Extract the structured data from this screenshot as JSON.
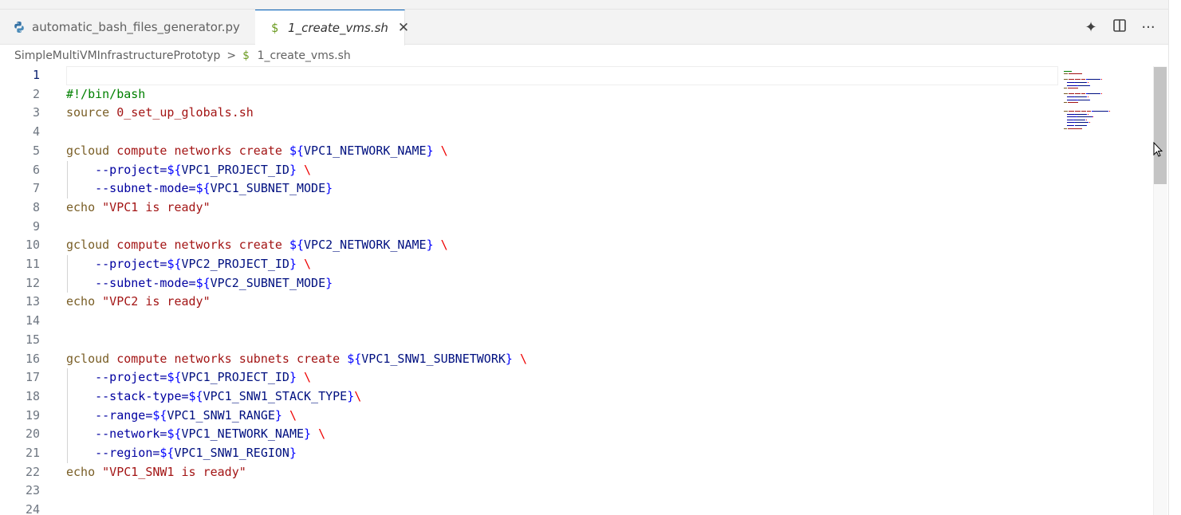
{
  "tabs": [
    {
      "label": "automatic_bash_files_generator.py",
      "icon": "python-icon",
      "active": false
    },
    {
      "label": "1_create_vms.sh",
      "icon": "dollar-icon",
      "active": true
    }
  ],
  "tab_icon_glyphs": {
    "dollar": "$",
    "close": "✕"
  },
  "actions": {
    "sparkle": "✦",
    "split": "◫",
    "more": "···"
  },
  "breadcrumb": {
    "folder": "SimpleMultiVMInfrastructurePrototyp",
    "separator": ">",
    "file_icon": "$",
    "file": "1_create_vms.sh"
  },
  "editor": {
    "current_line": 1,
    "lines": [
      {
        "n": "1",
        "tokens": []
      },
      {
        "n": "2",
        "tokens": [
          {
            "c": "shebang",
            "t": "#!/bin/bash"
          }
        ]
      },
      {
        "n": "3",
        "tokens": [
          {
            "c": "cmd",
            "t": "source"
          },
          {
            "c": "plain",
            "t": " "
          },
          {
            "c": "arg",
            "t": "0_set_up_globals.sh"
          }
        ]
      },
      {
        "n": "4",
        "tokens": []
      },
      {
        "n": "5",
        "tokens": [
          {
            "c": "cmd",
            "t": "gcloud"
          },
          {
            "c": "plain",
            "t": " "
          },
          {
            "c": "arg",
            "t": "compute"
          },
          {
            "c": "plain",
            "t": " "
          },
          {
            "c": "arg",
            "t": "networks"
          },
          {
            "c": "plain",
            "t": " "
          },
          {
            "c": "arg",
            "t": "create"
          },
          {
            "c": "plain",
            "t": " "
          },
          {
            "c": "brace",
            "t": "${"
          },
          {
            "c": "var",
            "t": "VPC1_NETWORK_NAME"
          },
          {
            "c": "brace",
            "t": "}"
          },
          {
            "c": "plain",
            "t": " "
          },
          {
            "c": "bs",
            "t": "\\"
          }
        ]
      },
      {
        "n": "6",
        "tokens": [
          {
            "c": "plain",
            "t": "    "
          },
          {
            "c": "flag",
            "t": "--project="
          },
          {
            "c": "brace",
            "t": "${"
          },
          {
            "c": "var",
            "t": "VPC1_PROJECT_ID"
          },
          {
            "c": "brace",
            "t": "}"
          },
          {
            "c": "plain",
            "t": " "
          },
          {
            "c": "bs",
            "t": "\\"
          }
        ]
      },
      {
        "n": "7",
        "tokens": [
          {
            "c": "plain",
            "t": "    "
          },
          {
            "c": "flag",
            "t": "--subnet-mode="
          },
          {
            "c": "brace",
            "t": "${"
          },
          {
            "c": "var",
            "t": "VPC1_SUBNET_MODE"
          },
          {
            "c": "brace",
            "t": "}"
          }
        ]
      },
      {
        "n": "8",
        "tokens": [
          {
            "c": "cmd",
            "t": "echo"
          },
          {
            "c": "plain",
            "t": " "
          },
          {
            "c": "str",
            "t": "\"VPC1 is ready\""
          }
        ]
      },
      {
        "n": "9",
        "tokens": []
      },
      {
        "n": "10",
        "tokens": [
          {
            "c": "cmd",
            "t": "gcloud"
          },
          {
            "c": "plain",
            "t": " "
          },
          {
            "c": "arg",
            "t": "compute"
          },
          {
            "c": "plain",
            "t": " "
          },
          {
            "c": "arg",
            "t": "networks"
          },
          {
            "c": "plain",
            "t": " "
          },
          {
            "c": "arg",
            "t": "create"
          },
          {
            "c": "plain",
            "t": " "
          },
          {
            "c": "brace",
            "t": "${"
          },
          {
            "c": "var",
            "t": "VPC2_NETWORK_NAME"
          },
          {
            "c": "brace",
            "t": "}"
          },
          {
            "c": "plain",
            "t": " "
          },
          {
            "c": "bs",
            "t": "\\"
          }
        ]
      },
      {
        "n": "11",
        "tokens": [
          {
            "c": "plain",
            "t": "    "
          },
          {
            "c": "flag",
            "t": "--project="
          },
          {
            "c": "brace",
            "t": "${"
          },
          {
            "c": "var",
            "t": "VPC2_PROJECT_ID"
          },
          {
            "c": "brace",
            "t": "}"
          },
          {
            "c": "plain",
            "t": " "
          },
          {
            "c": "bs",
            "t": "\\"
          }
        ]
      },
      {
        "n": "12",
        "tokens": [
          {
            "c": "plain",
            "t": "    "
          },
          {
            "c": "flag",
            "t": "--subnet-mode="
          },
          {
            "c": "brace",
            "t": "${"
          },
          {
            "c": "var",
            "t": "VPC2_SUBNET_MODE"
          },
          {
            "c": "brace",
            "t": "}"
          }
        ]
      },
      {
        "n": "13",
        "tokens": [
          {
            "c": "cmd",
            "t": "echo"
          },
          {
            "c": "plain",
            "t": " "
          },
          {
            "c": "str",
            "t": "\"VPC2 is ready\""
          }
        ]
      },
      {
        "n": "14",
        "tokens": []
      },
      {
        "n": "15",
        "tokens": []
      },
      {
        "n": "16",
        "tokens": [
          {
            "c": "cmd",
            "t": "gcloud"
          },
          {
            "c": "plain",
            "t": " "
          },
          {
            "c": "arg",
            "t": "compute"
          },
          {
            "c": "plain",
            "t": " "
          },
          {
            "c": "arg",
            "t": "networks"
          },
          {
            "c": "plain",
            "t": " "
          },
          {
            "c": "arg",
            "t": "subnets"
          },
          {
            "c": "plain",
            "t": " "
          },
          {
            "c": "arg",
            "t": "create"
          },
          {
            "c": "plain",
            "t": " "
          },
          {
            "c": "brace",
            "t": "${"
          },
          {
            "c": "var",
            "t": "VPC1_SNW1_SUBNETWORK"
          },
          {
            "c": "brace",
            "t": "}"
          },
          {
            "c": "plain",
            "t": " "
          },
          {
            "c": "bs",
            "t": "\\"
          }
        ]
      },
      {
        "n": "17",
        "tokens": [
          {
            "c": "plain",
            "t": "    "
          },
          {
            "c": "flag",
            "t": "--project="
          },
          {
            "c": "brace",
            "t": "${"
          },
          {
            "c": "var",
            "t": "VPC1_PROJECT_ID"
          },
          {
            "c": "brace",
            "t": "}"
          },
          {
            "c": "plain",
            "t": " "
          },
          {
            "c": "bs",
            "t": "\\"
          }
        ]
      },
      {
        "n": "18",
        "tokens": [
          {
            "c": "plain",
            "t": "    "
          },
          {
            "c": "flag",
            "t": "--stack-type="
          },
          {
            "c": "brace",
            "t": "${"
          },
          {
            "c": "var",
            "t": "VPC1_SNW1_STACK_TYPE"
          },
          {
            "c": "brace",
            "t": "}"
          },
          {
            "c": "bs",
            "t": "\\"
          }
        ]
      },
      {
        "n": "19",
        "tokens": [
          {
            "c": "plain",
            "t": "    "
          },
          {
            "c": "flag",
            "t": "--range="
          },
          {
            "c": "brace",
            "t": "${"
          },
          {
            "c": "var",
            "t": "VPC1_SNW1_RANGE"
          },
          {
            "c": "brace",
            "t": "}"
          },
          {
            "c": "plain",
            "t": " "
          },
          {
            "c": "bs",
            "t": "\\"
          }
        ]
      },
      {
        "n": "20",
        "tokens": [
          {
            "c": "plain",
            "t": "    "
          },
          {
            "c": "flag",
            "t": "--network="
          },
          {
            "c": "brace",
            "t": "${"
          },
          {
            "c": "var",
            "t": "VPC1_NETWORK_NAME"
          },
          {
            "c": "brace",
            "t": "}"
          },
          {
            "c": "plain",
            "t": " "
          },
          {
            "c": "bs",
            "t": "\\"
          }
        ]
      },
      {
        "n": "21",
        "tokens": [
          {
            "c": "plain",
            "t": "    "
          },
          {
            "c": "flag",
            "t": "--region="
          },
          {
            "c": "brace",
            "t": "${"
          },
          {
            "c": "var",
            "t": "VPC1_SNW1_REGION"
          },
          {
            "c": "brace",
            "t": "}"
          }
        ]
      },
      {
        "n": "22",
        "tokens": [
          {
            "c": "cmd",
            "t": "echo"
          },
          {
            "c": "plain",
            "t": " "
          },
          {
            "c": "str",
            "t": "\"VPC1_SNW1 is ready\""
          }
        ]
      },
      {
        "n": "23",
        "tokens": []
      },
      {
        "n": "24",
        "tokens": []
      }
    ]
  }
}
